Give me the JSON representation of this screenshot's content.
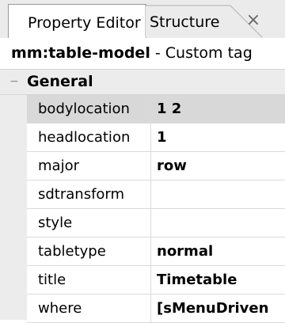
{
  "tabs": {
    "active_label": "Property Editor",
    "inactive_label": "Structure",
    "close_glyph": "×"
  },
  "header": {
    "tag_name": "mm:table-model",
    "suffix": " - Custom tag"
  },
  "category": {
    "collapse_glyph": "−",
    "label": "General"
  },
  "properties": [
    {
      "name": "bodylocation",
      "value": "1 2"
    },
    {
      "name": "headlocation",
      "value": "1"
    },
    {
      "name": "major",
      "value": "row"
    },
    {
      "name": "sdtransform",
      "value": ""
    },
    {
      "name": "style",
      "value": ""
    },
    {
      "name": "tabletype",
      "value": "normal"
    },
    {
      "name": "title",
      "value": "Timetable"
    },
    {
      "name": "where",
      "value": "[sMenuDriven"
    }
  ],
  "selected_property": "bodylocation",
  "colors": {
    "tab_strip_bg": "#ebebeb",
    "selected_row_bg": "#d8d8d8",
    "gutter_bg": "#ececec"
  }
}
